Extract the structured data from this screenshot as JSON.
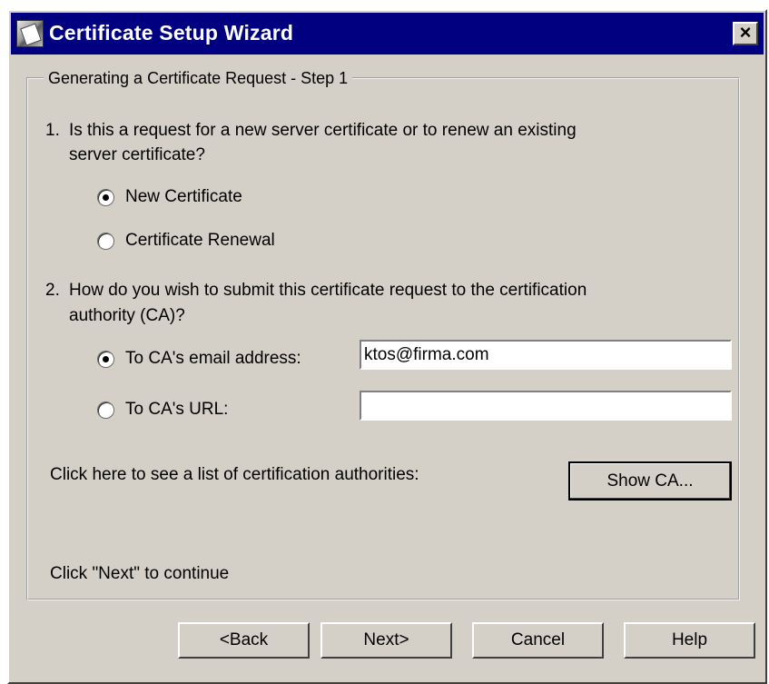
{
  "window": {
    "title": "Certificate Setup Wizard",
    "close_label": "×"
  },
  "group": {
    "legend": "Generating a Certificate Request - Step 1"
  },
  "question1": {
    "number": "1.",
    "text_line1": "Is this a request for a new server certificate or to renew an existing",
    "text_line2": "server certificate?",
    "options": [
      {
        "label": "New Certificate",
        "checked": true
      },
      {
        "label": "Certificate Renewal",
        "checked": false
      }
    ]
  },
  "question2": {
    "number": "2.",
    "text_line1": "How do you wish to submit this certificate request to the certification",
    "text_line2": "authority (CA)?",
    "options": [
      {
        "label": "To CA's email address:",
        "checked": true,
        "field_value": "ktos@firma.com"
      },
      {
        "label": "To CA's URL:",
        "checked": false,
        "field_value": ""
      }
    ]
  },
  "ca_list": {
    "prompt": "Click here to see a list of certification authorities:",
    "button_label": "Show CA..."
  },
  "footer_hint": "Click \"Next\" to continue",
  "buttons": {
    "back": "<Back",
    "next": "Next>",
    "cancel": "Cancel",
    "help": "Help"
  }
}
